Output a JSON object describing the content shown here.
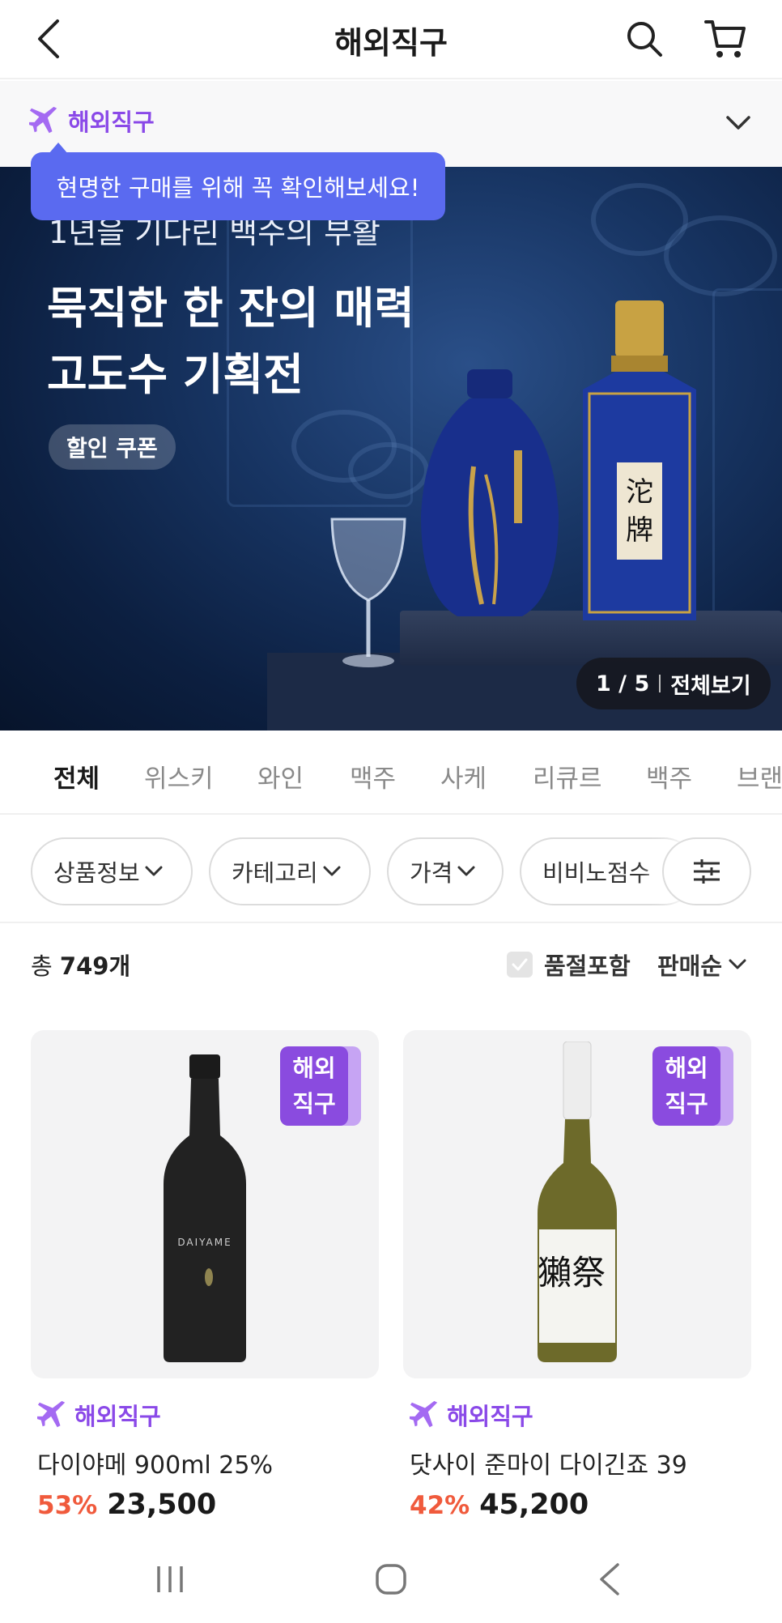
{
  "header": {
    "title": "해외직구",
    "back_icon": "chevron-left-icon",
    "search_icon": "search-icon",
    "cart_icon": "cart-icon"
  },
  "overseas_bar": {
    "label": "해외직구",
    "icon": "airplane-icon",
    "tooltip": "현명한 구매를 위해 꼭 확인해보세요!"
  },
  "banner": {
    "subtitle": "1년을 기다린 백수의 부활",
    "title_line1": "묵직한 한 잔의 매력",
    "title_line2": "고도수 기획전",
    "coupon_label": "할인 쿠폰",
    "counter": "1 / 5",
    "view_all": "전체보기"
  },
  "tabs": [
    "전체",
    "위스키",
    "와인",
    "맥주",
    "사케",
    "리큐르",
    "백주",
    "브랜"
  ],
  "filters": [
    "상품정보",
    "카테고리",
    "가격",
    "비비노점수"
  ],
  "list": {
    "total_prefix": "총",
    "total_count": "749개",
    "soldout_label": "품절포함",
    "sort_label": "판매순"
  },
  "products": [
    {
      "badge_line1": "해외",
      "badge_line2": "직구",
      "tag": "해외직구",
      "name": "다이야메 900ml 25%",
      "discount": "53%",
      "price": "23,500",
      "bottle_label": "DAIYAME"
    },
    {
      "badge_line1": "해외",
      "badge_line2": "직구",
      "tag": "해외직구",
      "name": "닷사이 준마이 다이긴죠 39",
      "discount": "42%",
      "price": "45,200",
      "bottle_label": "獺祭"
    }
  ],
  "colors": {
    "accent_purple": "#8a49e8",
    "tooltip_blue": "#5a6af0",
    "discount_red": "#f05a3c"
  }
}
